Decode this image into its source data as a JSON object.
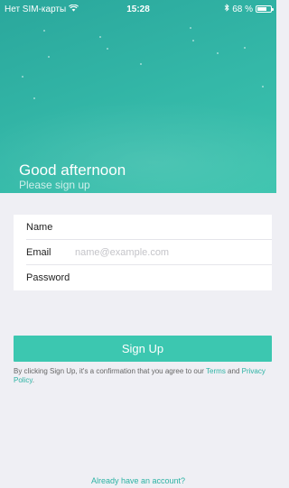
{
  "status_bar": {
    "carrier": "Нет SIM-карты",
    "wifi_icon": "wifi-icon",
    "time": "15:28",
    "bluetooth_icon": "bluetooth-icon",
    "battery_percent": "68 %",
    "battery_level": 0.68
  },
  "hero": {
    "greeting": "Good afternoon",
    "subtitle": "Please sign up",
    "gradient_start": "#2aa79c",
    "gradient_end": "#3cc4ae"
  },
  "form": {
    "name_label": "Name",
    "name_value": "",
    "email_label": "Email",
    "email_placeholder": "name@example.com",
    "email_value": "",
    "password_label": "Password",
    "password_value": ""
  },
  "signup_button": {
    "label": "Sign Up",
    "color": "#3cc7b0"
  },
  "terms": {
    "prefix": "By clicking Sign Up, it's a confirmation that you agree to our ",
    "terms_link": "Terms",
    "middle": " and ",
    "privacy_link": "Privacy Policy",
    "suffix": "."
  },
  "footer": {
    "login_link": "Already have an account?"
  }
}
